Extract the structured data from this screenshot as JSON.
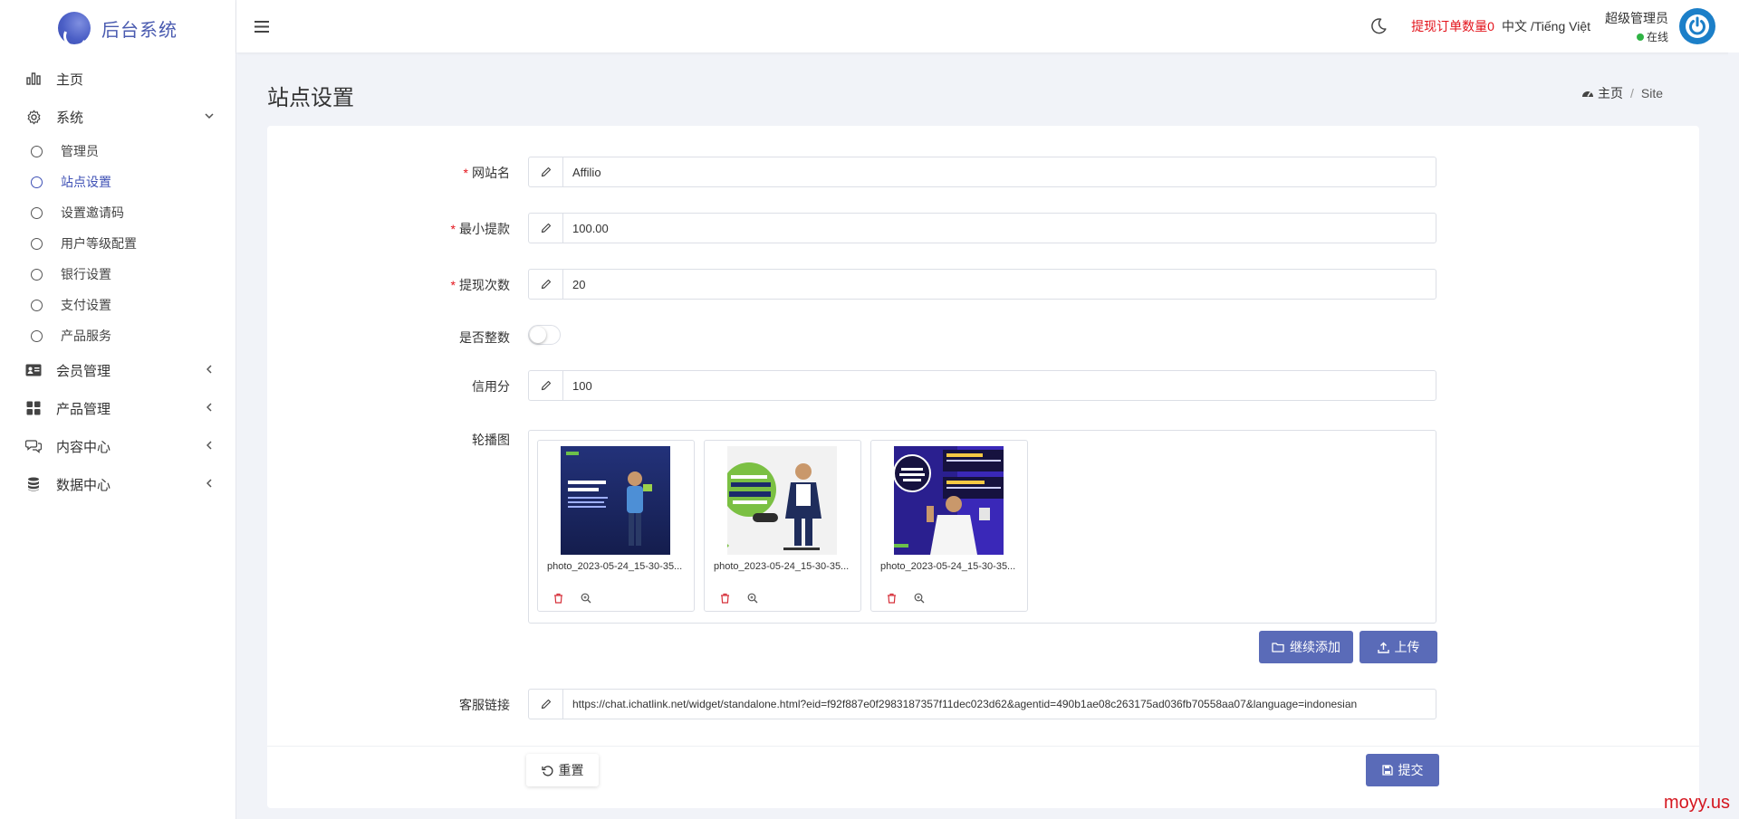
{
  "brand": {
    "title": "后台系统"
  },
  "sidebar": {
    "menu": [
      {
        "label": "主页",
        "icon": "bar-chart-icon"
      },
      {
        "label": "系统",
        "icon": "gear-icon",
        "expanded": true
      }
    ],
    "system_children": [
      {
        "label": "管理员"
      },
      {
        "label": "站点设置",
        "active": true
      },
      {
        "label": "设置邀请码"
      },
      {
        "label": "用户等级配置"
      },
      {
        "label": "银行设置"
      },
      {
        "label": "支付设置"
      },
      {
        "label": "产品服务"
      }
    ],
    "groups": [
      {
        "label": "会员管理",
        "icon": "id-card-icon"
      },
      {
        "label": "产品管理",
        "icon": "grid-icon"
      },
      {
        "label": "内容中心",
        "icon": "chat-icon"
      },
      {
        "label": "数据中心",
        "icon": "database-icon"
      }
    ]
  },
  "header": {
    "pending_withdrawals": "提现订单数量0",
    "language": "中文 /Tiếng Việt",
    "user_name": "超级管理员",
    "user_status": "在线"
  },
  "page": {
    "title": "站点设置",
    "breadcrumb_home": "主页",
    "breadcrumb_current": "Site"
  },
  "form": {
    "site_name": {
      "label": "网站名",
      "required": true,
      "value": "Affilio"
    },
    "min_withdraw": {
      "label": "最小提款",
      "required": true,
      "value": "100.00"
    },
    "withdraw_times": {
      "label": "提现次数",
      "required": true,
      "value": "20"
    },
    "integer_only": {
      "label": "是否整数",
      "on": false
    },
    "credit_score": {
      "label": "信用分",
      "value": "100"
    },
    "carousel": {
      "label": "轮播图",
      "images": [
        {
          "filename": "photo_2023-05-24_15-30-35..."
        },
        {
          "filename": "photo_2023-05-24_15-30-35..."
        },
        {
          "filename": "photo_2023-05-24_15-30-35..."
        }
      ],
      "add_more_label": "继续添加",
      "upload_label": "上传"
    },
    "service_link": {
      "label": "客服链接",
      "value": "https://chat.ichatlink.net/widget/standalone.html?eid=f92f887e0f2983187357f11dec023d62&agentid=490b1ae08c263175ad036fb70558aa07&language=indonesian"
    },
    "reset_label": "重置",
    "submit_label": "提交"
  },
  "watermark": "moyy.us"
}
